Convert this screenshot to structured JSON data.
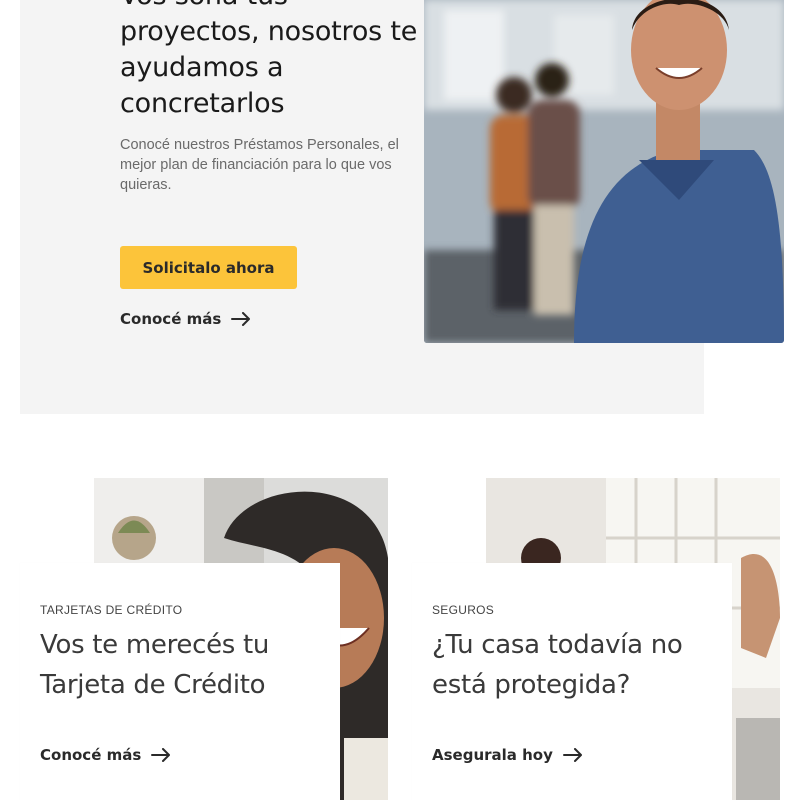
{
  "hero": {
    "title": "Vos soñá tus proyectos, nosotros te ayudamos a concretarlos",
    "description": "Conocé nuestros Préstamos Personales, el mejor plan de financiación para lo que vos quieras.",
    "primary_button": "Solicitalo ahora",
    "link": "Conocé más",
    "photo_icon": "man-smiling-photo"
  },
  "cards": [
    {
      "eyebrow": "TARJETAS DE CRÉDITO",
      "title": "Vos te merecés tu Tarjeta de Crédito",
      "link": "Conocé más",
      "photo_icon": "woman-smiling-photo"
    },
    {
      "eyebrow": "SEGUROS",
      "title": "¿Tu casa todavía no está protegida?",
      "link": "Asegurala hoy",
      "photo_icon": "people-at-home-photo"
    }
  ],
  "colors": {
    "accent": "#fcc43a",
    "panel": "#f4f4f4",
    "text": "#1e1e1e"
  }
}
